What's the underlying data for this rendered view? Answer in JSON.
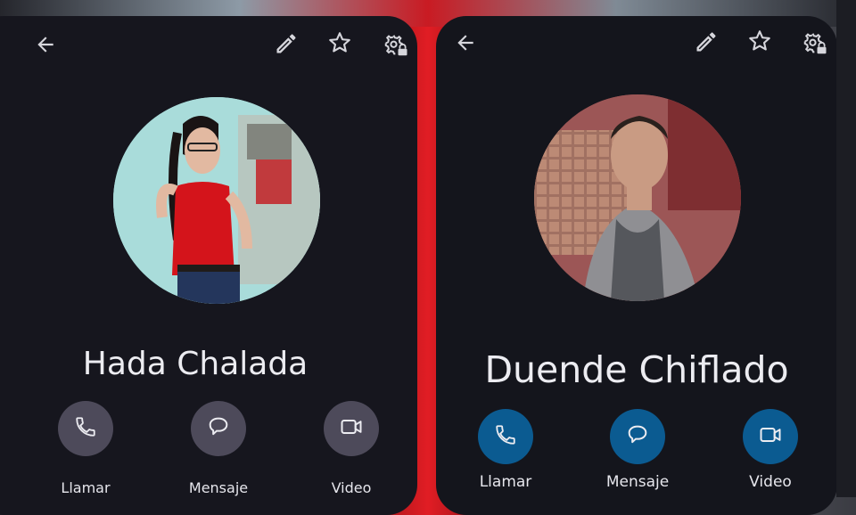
{
  "colors": {
    "panel_bg": "#16161e",
    "left_action_bg": "#4d4a5a",
    "right_action_bg": "#0b5b91",
    "text": "#ececf1"
  },
  "left_contact": {
    "name": "Hada Chalada",
    "actions": [
      {
        "label": "Llamar",
        "icon": "phone-icon"
      },
      {
        "label": "Mensaje",
        "icon": "message-icon"
      },
      {
        "label": "Video",
        "icon": "video-icon"
      }
    ],
    "toolbar_icons": [
      "back-arrow-icon",
      "edit-pencil-icon",
      "star-icon",
      "settings-lock-icon"
    ]
  },
  "right_contact": {
    "name": "Duende Chiflado",
    "actions": [
      {
        "label": "Llamar",
        "icon": "phone-icon"
      },
      {
        "label": "Mensaje",
        "icon": "message-icon"
      },
      {
        "label": "Video",
        "icon": "video-icon"
      }
    ],
    "toolbar_icons": [
      "back-arrow-icon",
      "edit-pencil-icon",
      "star-icon",
      "settings-lock-icon"
    ]
  }
}
